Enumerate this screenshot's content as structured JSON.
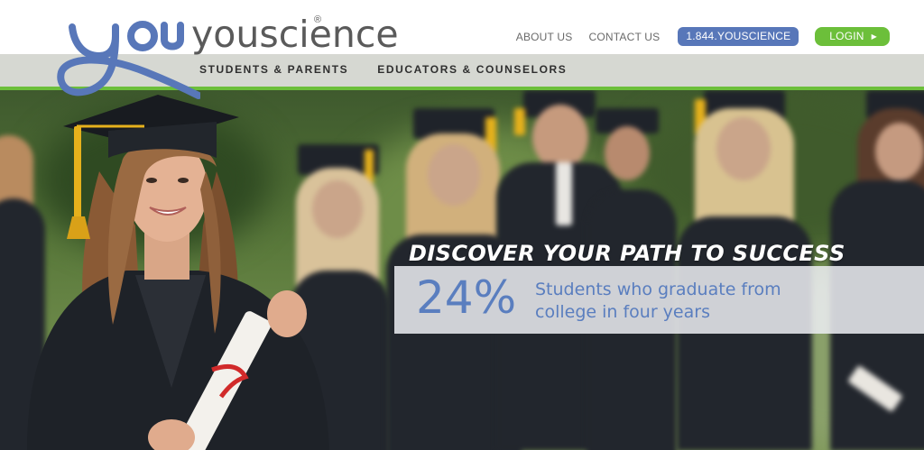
{
  "brand": {
    "name": "youscience",
    "registered_mark": "®",
    "colors": {
      "blue": "#5877b9",
      "green": "#6cbf3a",
      "text_gray": "#5a5a5a"
    }
  },
  "top_links": {
    "about": "ABOUT US",
    "contact": "CONTACT US",
    "phone": "1.844.YOUSCIENCE",
    "login": "LOGIN",
    "login_icon": "caret-right-icon"
  },
  "main_nav": [
    {
      "label": "STUDENTS & PARENTS"
    },
    {
      "label": "EDUCATORS & COUNSELORS"
    }
  ],
  "hero": {
    "headline": "DISCOVER YOUR PATH TO SUCCESS",
    "stat_value": "24%",
    "stat_text": "Students who graduate from college in four years"
  }
}
